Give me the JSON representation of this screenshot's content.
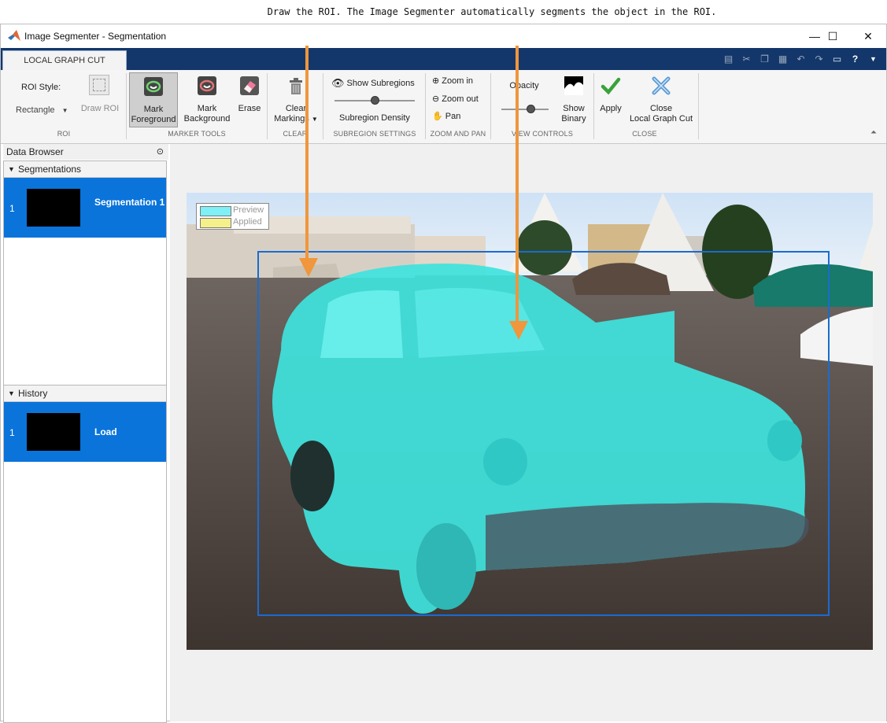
{
  "caption": "Draw the ROI. The Image Segmenter automatically segments the object in the ROI.",
  "window": {
    "title": "Image Segmenter - Segmentation",
    "controls": {
      "minimize": "—",
      "maximize": "☐",
      "close": "✕"
    }
  },
  "tabs": [
    {
      "label": "LOCAL GRAPH CUT",
      "selected": true
    }
  ],
  "quick_access_icons": [
    "save-icon",
    "cut-icon",
    "copy-icon",
    "paste-icon",
    "undo-icon",
    "redo-icon",
    "window-icon",
    "help-icon",
    "dropdown-icon"
  ],
  "ribbon": {
    "roi": {
      "style_label": "ROI Style:",
      "shape_value": "Rectangle",
      "draw_roi_label": "Draw ROI",
      "section_label": "ROI"
    },
    "marker_tools": {
      "mark_foreground": [
        "Mark",
        "Foreground"
      ],
      "mark_background": [
        "Mark",
        "Background"
      ],
      "erase": "Erase",
      "section_label": "MARKER TOOLS"
    },
    "clear": {
      "clear_markings": [
        "Clear",
        "Markings"
      ],
      "section_label": "CLEAR"
    },
    "subregion_settings": {
      "show_subregions": "Show Subregions",
      "subregion_density": "Subregion Density",
      "section_label": "SUBREGION SETTINGS"
    },
    "zoom_and_pan": {
      "zoom_in": "Zoom in",
      "zoom_out": "Zoom out",
      "pan": "Pan",
      "section_label": "ZOOM AND PAN"
    },
    "view_controls": {
      "opacity": "Opacity",
      "show_binary": [
        "Show",
        "Binary"
      ],
      "section_label": "VIEW CONTROLS"
    },
    "close": {
      "apply": "Apply",
      "close_graph_cut": [
        "Close",
        "Local Graph Cut"
      ],
      "section_label": "CLOSE"
    }
  },
  "data_browser": {
    "title": "Data Browser",
    "segmentations": {
      "header": "Segmentations",
      "items": [
        {
          "index": "1",
          "label": "Segmentation 1"
        }
      ]
    },
    "history": {
      "header": "History",
      "items": [
        {
          "index": "1",
          "label": "Load"
        }
      ]
    }
  },
  "legend": {
    "items": [
      {
        "label": "Preview",
        "color": "#7ff0f5"
      },
      {
        "label": "Applied",
        "color": "#f5f08a"
      }
    ]
  },
  "colors": {
    "accent_blue": "#0a74da",
    "tab_strip": "#13376b",
    "roi_rectangle": "#1b6bd0",
    "annotation_arrow": "#f0963c",
    "preview_overlay": "#3ee6e0"
  }
}
